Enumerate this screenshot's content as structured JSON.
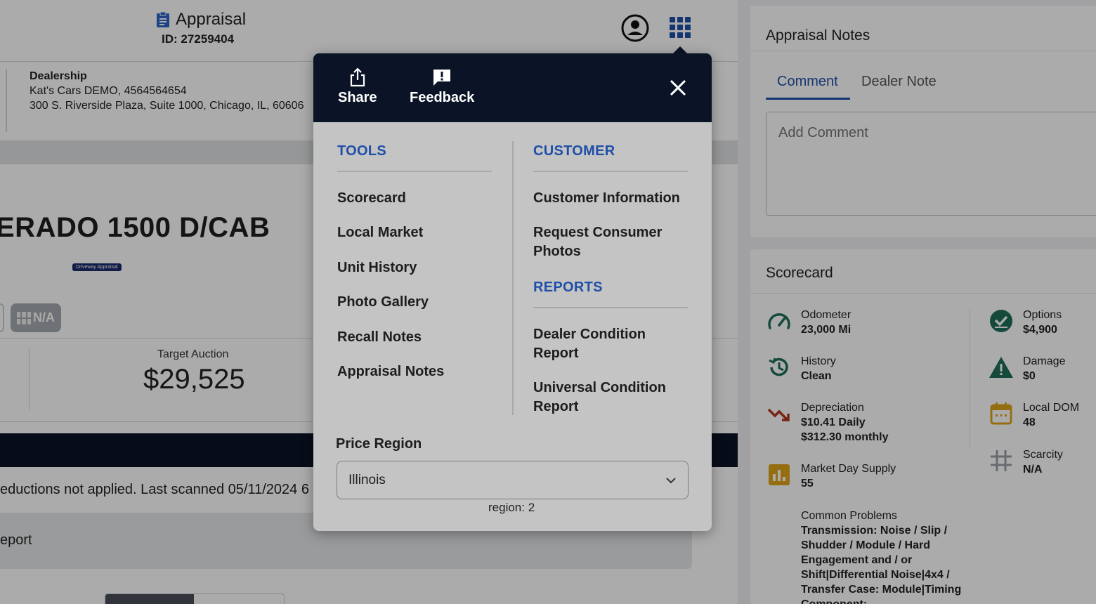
{
  "header": {
    "title": "Appraisal",
    "id_text": "ID: 27259404"
  },
  "dealership": {
    "label": "Dealership",
    "name_phone": "Kat's Cars DEMO, 4564564654",
    "address": "300 S. Riverside Plaza, Suite 1000, Chicago, IL, 60606"
  },
  "vehicle": {
    "title": "ERADO 1500 D/CAB",
    "badge": "Driveway Appraisal",
    "chip": "N/A"
  },
  "pricing": {
    "target_label": "Target Auction",
    "target_value": "$29,525"
  },
  "scan_text": "eductions not applied. Last scanned 05/11/2024 6",
  "report_text": "eport",
  "notes": {
    "title": "Appraisal Notes",
    "tabs": [
      {
        "label": "Comment"
      },
      {
        "label": "Dealer Note"
      }
    ],
    "comment_placeholder": "Add Comment"
  },
  "scorecard": {
    "title": "Scorecard",
    "metrics": [
      {
        "label": "Odometer",
        "value": "23,000 Mi",
        "icon": "gauge-icon",
        "color": "#1f6e5a"
      },
      {
        "label": "History",
        "value": "Clean",
        "icon": "history-icon",
        "color": "#1f6e5a"
      },
      {
        "label": "Depreciation",
        "value": "$10.41 Daily",
        "value2": "$312.30 monthly",
        "icon": "trend-down-icon",
        "color": "#b3351a"
      },
      {
        "label": "Market Day Supply",
        "value": "55",
        "icon": "bar-chart-icon",
        "color": "#e0a51c"
      },
      {
        "label": "Common Problems",
        "value": "Transmission: Noise / Slip / Shudder / Module / Hard Engagement and / or Shift|Differential Noise|4x4 / Transfer Case: Module|Timing Component:"
      },
      {
        "label": "Options",
        "value": "$4,900",
        "icon": "check-circle-icon",
        "color": "#1f6e5a"
      },
      {
        "label": "Damage",
        "value": "$0",
        "icon": "warning-icon",
        "color": "#1f6e5a"
      },
      {
        "label": "Local DOM",
        "value": "48",
        "icon": "calendar-icon",
        "color": "#e0a51c"
      },
      {
        "label": "Scarcity",
        "value": "N/A",
        "icon": "scarcity-grid-icon",
        "color": "#9a9ea6"
      }
    ]
  },
  "menu": {
    "share_label": "Share",
    "feedback_label": "Feedback",
    "tools_title": "TOOLS",
    "tools": [
      "Scorecard",
      "Local Market",
      "Unit History",
      "Photo Gallery",
      "Recall Notes",
      "Appraisal Notes"
    ],
    "customer_title": "CUSTOMER",
    "customer": [
      "Customer Information",
      "Request Consumer Photos"
    ],
    "reports_title": "REPORTS",
    "reports": [
      "Dealer Condition Report",
      "Universal Condition Report"
    ],
    "region_label": "Price Region",
    "region_value": "Illinois",
    "region_note": "region: 2"
  },
  "colors": {
    "accent": "#1f4fa8",
    "menu_header": "#0b1326",
    "menu_body": "#c4c4c4"
  }
}
